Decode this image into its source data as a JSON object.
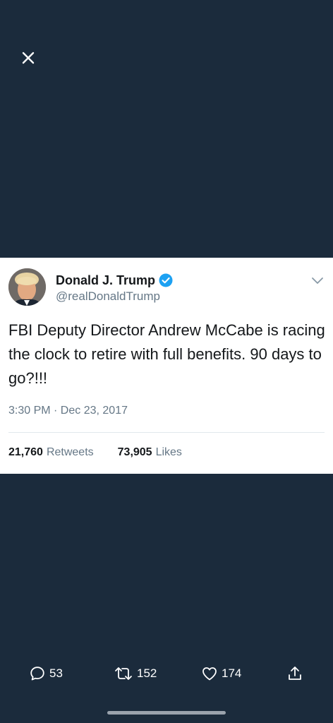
{
  "close": {
    "icon": "close-icon"
  },
  "tweet": {
    "display_name": "Donald J. Trump",
    "handle": "@realDonaldTrump",
    "text": "FBI Deputy Director Andrew McCabe is racing the clock to retire with full benefits. 90 days to go?!!!",
    "timestamp": "3:30 PM · Dec 23, 2017",
    "retweets_count": "21,760",
    "retweets_label": "Retweets",
    "likes_count": "73,905",
    "likes_label": "Likes"
  },
  "actions": {
    "replies": "53",
    "retweets": "152",
    "likes": "174"
  },
  "colors": {
    "background": "#1b2b3c",
    "card": "#ffffff",
    "verified": "#1da1f2",
    "secondary_text": "#657786"
  }
}
